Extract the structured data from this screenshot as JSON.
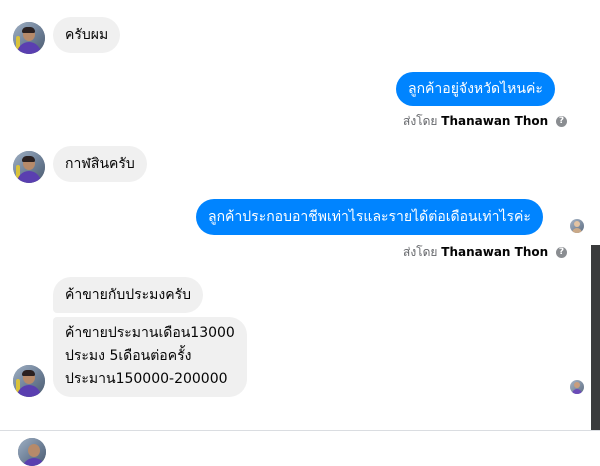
{
  "messages": {
    "m1": "ครับผม",
    "m2": "ลูกค้าอยู่จังหวัดไหนค่ะ",
    "m3": "กาฬสินครับ",
    "m4": "ลูกค้าประกอบอาชีพเท่าไรและรายได้ต่อเดือนเท่าไรค่ะ",
    "m5": "ค้าขายกับประมงครับ",
    "m6": [
      "ค้าขายประมานเดือน13000",
      "ประมง 5เดือนต่อครั้ง",
      "ประมาน150000-200000"
    ]
  },
  "sent_by": {
    "prefix": "ส่งโดย",
    "name": "Thanawan Thon"
  },
  "icons": {
    "help": "question-circle-icon"
  },
  "colors": {
    "outgoing": "#0084ff",
    "incoming": "#f0f0f0"
  }
}
